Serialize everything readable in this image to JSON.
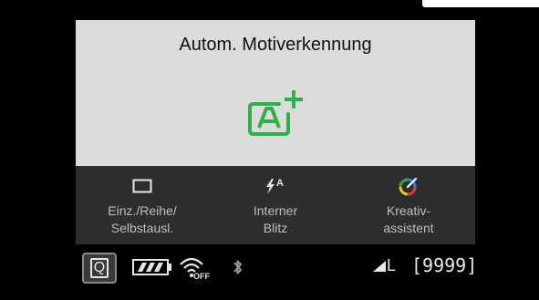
{
  "screen": {
    "mode_title": "Autom. Motiverkennung",
    "mode_icon": "scene-intelligent-auto-plus-icon",
    "accent_color": "#2bb34a"
  },
  "settings": [
    {
      "icon": "single-shooting-icon",
      "label_line1": "Einz./Reihe/",
      "label_line2": "Selbstausl."
    },
    {
      "icon": "auto-flash-icon",
      "icon_text": "A",
      "label_line1": "Interner",
      "label_line2": "Blitz"
    },
    {
      "icon": "creative-assist-icon",
      "label_line1": "Kreativ-",
      "label_line2": "assistent"
    }
  ],
  "status": {
    "q_label": "Q",
    "battery_icon": "battery-full-icon",
    "wifi_icon": "wifi-off-icon",
    "wifi_state": "OFF",
    "bluetooth_icon": "bluetooth-icon",
    "quality_icon": "image-quality-fine-icon",
    "quality": "L",
    "shots_remaining": "[9999]"
  }
}
